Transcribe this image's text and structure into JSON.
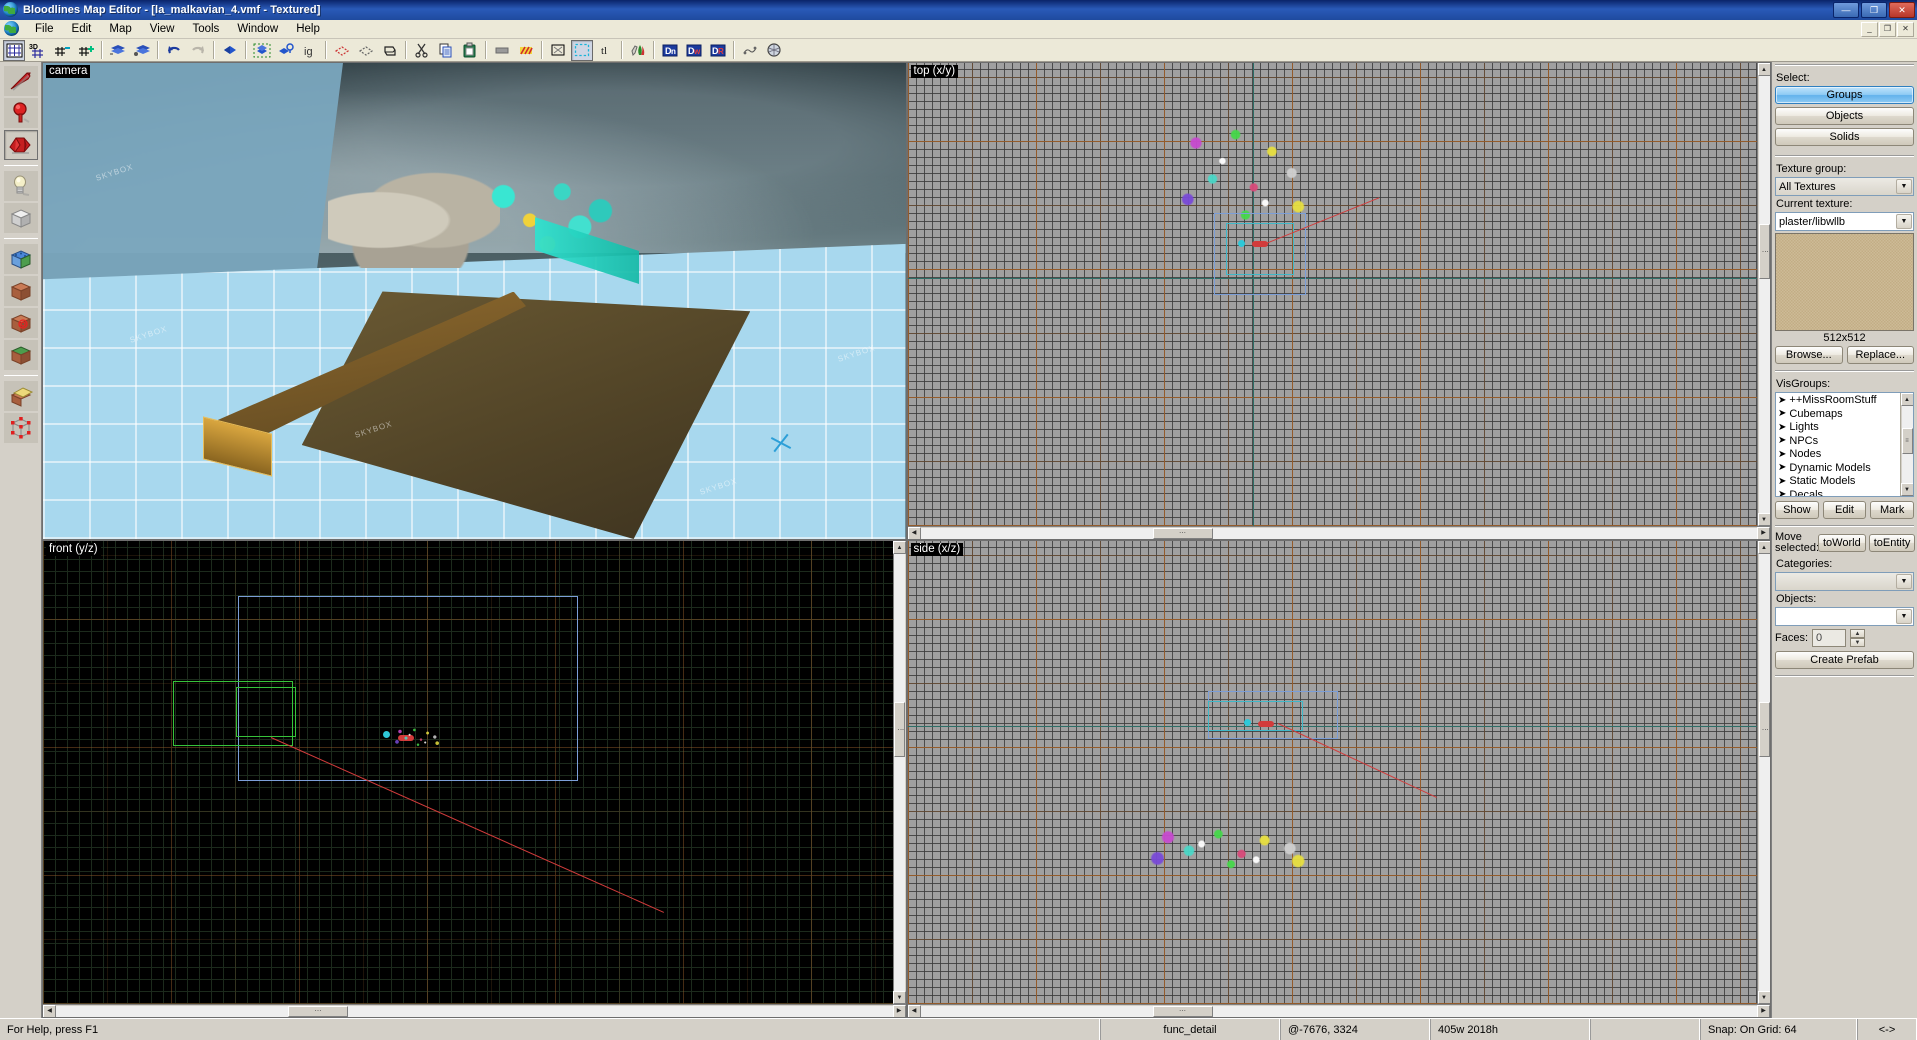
{
  "window": {
    "title": "Bloodlines Map Editor - [la_malkavian_4.vmf - Textured]",
    "app_icon": "globe-icon",
    "minimize_label": "—",
    "maximize_label": "❐",
    "close_label": "✕",
    "mdi_minimize": "_",
    "mdi_restore": "❐",
    "mdi_close": "✕"
  },
  "menu": {
    "items": [
      {
        "label": "File",
        "name": "menu-file"
      },
      {
        "label": "Edit",
        "name": "menu-edit"
      },
      {
        "label": "Map",
        "name": "menu-map"
      },
      {
        "label": "View",
        "name": "menu-view"
      },
      {
        "label": "Tools",
        "name": "menu-tools"
      },
      {
        "label": "Window",
        "name": "menu-window"
      },
      {
        "label": "Help",
        "name": "menu-help"
      }
    ]
  },
  "toolbar": {
    "buttons": [
      {
        "name": "toggle-grid-icon",
        "tip": "Toggle grid",
        "pressed": true
      },
      {
        "name": "toggle-3d-grid-icon",
        "tip": "Toggle 3D grid",
        "pressed": false
      },
      {
        "name": "grid-smaller-icon",
        "tip": "Smaller grid",
        "pressed": false
      },
      {
        "name": "grid-larger-icon",
        "tip": "Larger grid",
        "pressed": false
      },
      {
        "name": "load-pointfile-icon",
        "tip": "Load pointfile",
        "pressed": false
      },
      {
        "name": "save-pointfile-icon",
        "tip": "Save pointfile",
        "pressed": false
      },
      {
        "name": "undo-icon",
        "tip": "Undo",
        "pressed": false
      },
      {
        "name": "redo-icon",
        "tip": "Redo",
        "pressed": false
      },
      {
        "name": "carve-icon",
        "tip": "Carve",
        "pressed": false
      },
      {
        "name": "group-icon",
        "tip": "Group",
        "pressed": false
      },
      {
        "name": "ungroup-icon",
        "tip": "Ungroup",
        "pressed": false
      },
      {
        "name": "ignore-groups-icon",
        "tip": "Ignore groups",
        "pressed": false
      },
      {
        "name": "hide-selected-icon",
        "tip": "Hide selected objects",
        "pressed": false
      },
      {
        "name": "hide-unselected-icon",
        "tip": "Hide unselected objects",
        "pressed": false
      },
      {
        "name": "show-hidden-icon",
        "tip": "Show hidden objects",
        "pressed": false
      },
      {
        "name": "cut-icon",
        "tip": "Cut",
        "pressed": false
      },
      {
        "name": "copy-icon",
        "tip": "Copy",
        "pressed": false
      },
      {
        "name": "paste-icon",
        "tip": "Paste",
        "pressed": false
      },
      {
        "name": "toggle-texture-lock-icon",
        "tip": "Texture lock",
        "pressed": false
      },
      {
        "name": "toggle-texture-app-icon",
        "tip": "Texture application",
        "pressed": false
      },
      {
        "name": "cordon-tool-icon",
        "tip": "Cordon tool",
        "pressed": false
      },
      {
        "name": "selection-tool-icon",
        "tip": "Selection mode",
        "pressed": true
      },
      {
        "name": "entity-report-icon",
        "tip": "Entity report",
        "pressed": false
      },
      {
        "name": "apply-current-texture-icon",
        "tip": "Apply current texture",
        "pressed": false
      },
      {
        "name": "run-map-icon",
        "tip": "Run map",
        "pressed": false
      },
      {
        "name": "display-walkthrough-icon",
        "tip": "Display walkthrough",
        "pressed": false
      },
      {
        "name": "display-radius-icon",
        "tip": "Display radius culling",
        "pressed": false
      },
      {
        "name": "autosave-icon",
        "tip": "Autosave",
        "pressed": false
      },
      {
        "name": "help-about-icon",
        "tip": "Help",
        "pressed": false
      }
    ]
  },
  "tools": {
    "items": [
      {
        "name": "tool-select",
        "label": "Selection Tool",
        "active": false
      },
      {
        "name": "tool-magnify",
        "label": "Magnify",
        "active": false
      },
      {
        "name": "tool-camera",
        "label": "Camera",
        "active": true
      },
      {
        "name": "tool-entity",
        "label": "Entity Tool",
        "active": false
      },
      {
        "name": "tool-block",
        "label": "Block Tool",
        "active": false
      },
      {
        "name": "tool-toggle-texture",
        "label": "Toggle Texture Application",
        "active": false
      },
      {
        "name": "tool-apply-texture",
        "label": "Apply Current Texture",
        "active": false
      },
      {
        "name": "tool-decal",
        "label": "Apply Decals",
        "active": false
      },
      {
        "name": "tool-overlay",
        "label": "Apply Overlays",
        "active": false
      },
      {
        "name": "tool-clipping",
        "label": "Clipping Tool",
        "active": false
      },
      {
        "name": "tool-vertex",
        "label": "Vertex Tool",
        "active": false
      }
    ]
  },
  "viewports": [
    {
      "name": "viewport-camera",
      "label": "camera",
      "type": "3d"
    },
    {
      "name": "viewport-top",
      "label": "top (x/y)",
      "type": "2d"
    },
    {
      "name": "viewport-front",
      "label": "front (y/z)",
      "type": "2d"
    },
    {
      "name": "viewport-side",
      "label": "side (x/z)",
      "type": "2d"
    }
  ],
  "sidebar": {
    "select": {
      "label": "Select:",
      "options": [
        {
          "label": "Groups",
          "name": "select-groups-button",
          "selected": true
        },
        {
          "label": "Objects",
          "name": "select-objects-button",
          "selected": false
        },
        {
          "label": "Solids",
          "name": "select-solids-button",
          "selected": false
        }
      ]
    },
    "texture_group": {
      "label": "Texture group:",
      "value": "All Textures"
    },
    "current_texture": {
      "label": "Current texture:",
      "value": "plaster/libwllb",
      "size": "512x512"
    },
    "texture_buttons": [
      {
        "label": "Browse...",
        "name": "texture-browse-button"
      },
      {
        "label": "Replace...",
        "name": "texture-replace-button"
      }
    ],
    "visgroups": {
      "label": "VisGroups:",
      "items": [
        "++MissRoomStuff",
        "Cubemaps",
        "Lights",
        "NPCs",
        "Nodes",
        "Dynamic Models",
        "Static Models",
        "Decals"
      ],
      "buttons": [
        {
          "label": "Show",
          "name": "visgroup-show-button"
        },
        {
          "label": "Edit",
          "name": "visgroup-edit-button"
        },
        {
          "label": "Mark",
          "name": "visgroup-mark-button"
        }
      ]
    },
    "move_selected": {
      "label": "Move selected:",
      "buttons": [
        {
          "label": "toWorld",
          "name": "move-to-world-button"
        },
        {
          "label": "toEntity",
          "name": "move-to-entity-button"
        }
      ]
    },
    "categories": {
      "label": "Categories:",
      "value": ""
    },
    "objects": {
      "label": "Objects:",
      "value": ""
    },
    "faces": {
      "label": "Faces:",
      "value": "0"
    },
    "create_prefab": {
      "label": "Create Prefab",
      "name": "create-prefab-button"
    }
  },
  "statusbar": {
    "help": "For Help, press F1",
    "selection": "func_detail",
    "coords": "@-7676, 3324",
    "dimensions": "405w 2018h",
    "empty": "",
    "snap": "Snap: On Grid: 64",
    "mode": "<->"
  }
}
